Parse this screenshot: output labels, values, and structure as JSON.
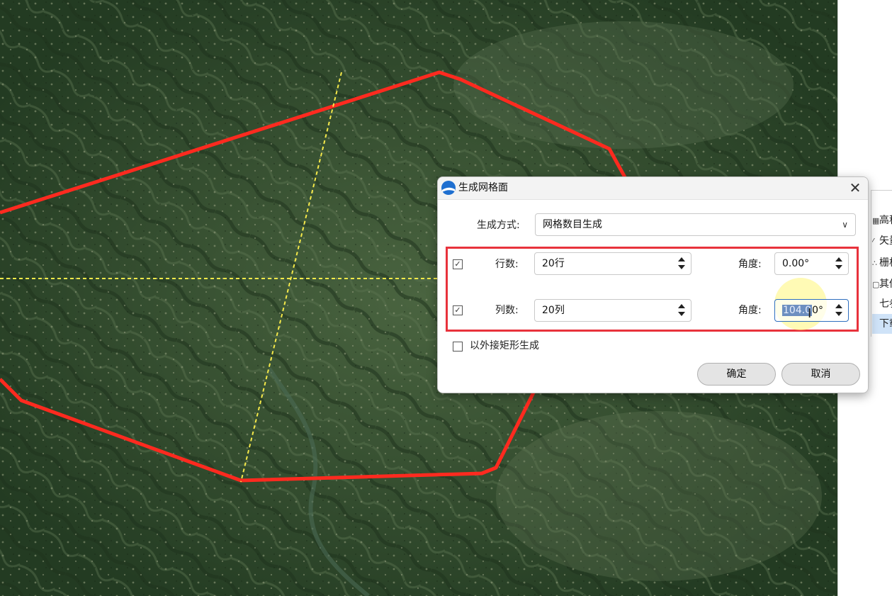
{
  "dialog": {
    "title": "生成网格面",
    "close_icon": "close-icon",
    "method_label": "生成方式:",
    "method_value": "网格数目生成",
    "rows_label": "行数:",
    "rows_value": "20行",
    "rows_checked": true,
    "rows_angle_label": "角度:",
    "rows_angle_value": "0.00°",
    "cols_label": "列数:",
    "cols_value": "20列",
    "cols_checked": true,
    "cols_angle_label": "角度:",
    "cols_angle_selected": "104.0",
    "cols_angle_rest": "0°",
    "bbox_label": "以外接矩形生成",
    "bbox_checked": false,
    "ok_label": "确定",
    "cancel_label": "取消"
  },
  "right_panel": {
    "items": [
      {
        "icon": "▦",
        "label": "高程"
      },
      {
        "icon": "⁄",
        "label": "矢量"
      },
      {
        "icon": "∴",
        "label": "栅格"
      },
      {
        "icon": "▢",
        "label": "其他"
      },
      {
        "icon": "",
        "label": "七参"
      },
      {
        "icon": "",
        "label": "下载"
      }
    ]
  },
  "colors": {
    "boundary": "#ff2a1f",
    "guide": "#f5e94a",
    "highlight_box": "#e8323c"
  }
}
